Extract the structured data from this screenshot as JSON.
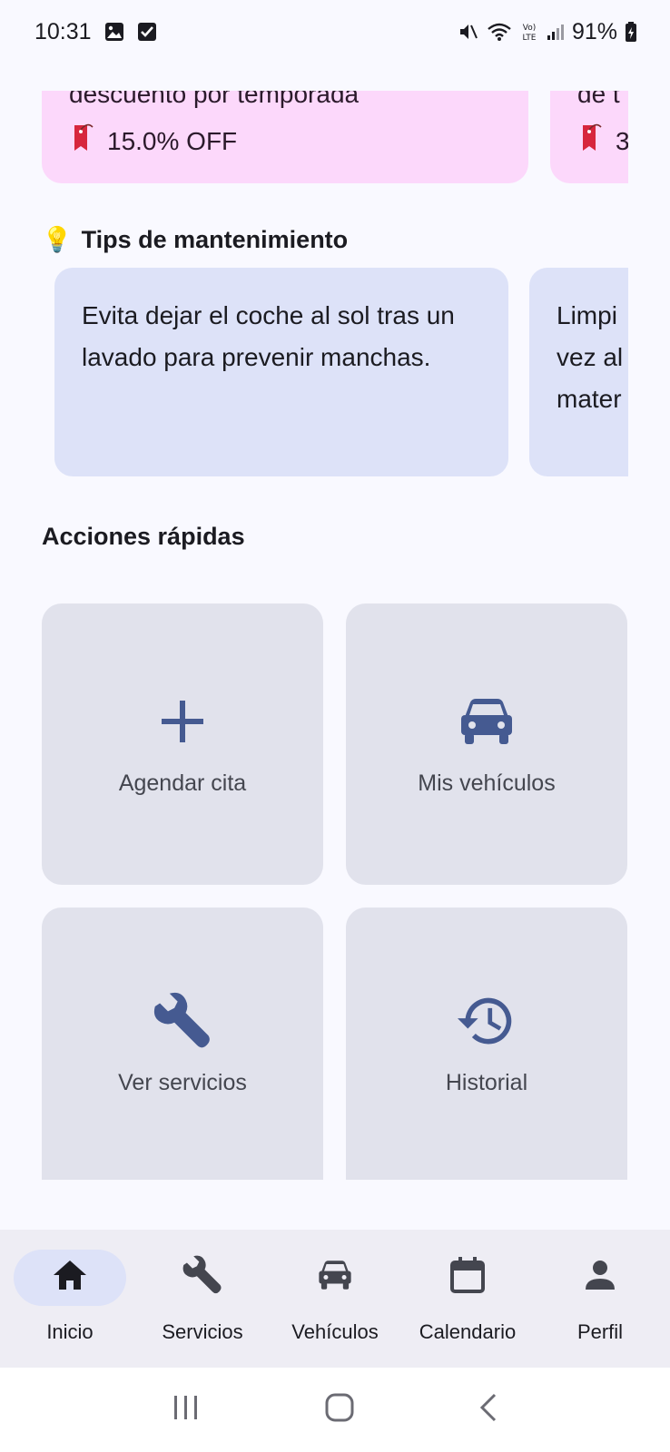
{
  "status": {
    "time": "10:31",
    "battery": "91%"
  },
  "promos": [
    {
      "description": "descuento por temporada",
      "discount": "15.0% OFF"
    },
    {
      "description": "de t",
      "discount": "3"
    }
  ],
  "tips": {
    "emoji": "💡",
    "title": "Tips de mantenimiento",
    "items": [
      "Evita dejar el coche al sol tras un lavado para prevenir manchas.",
      "Limpi\nvez al\nmater"
    ]
  },
  "actions": {
    "title": "Acciones rápidas",
    "items": [
      {
        "label": "Agendar cita",
        "icon": "plus-icon"
      },
      {
        "label": "Mis vehículos",
        "icon": "car-icon"
      },
      {
        "label": "Ver servicios",
        "icon": "wrench-icon"
      },
      {
        "label": "Historial",
        "icon": "history-icon"
      }
    ]
  },
  "nav": {
    "items": [
      {
        "label": "Inicio",
        "icon": "home-icon",
        "active": true
      },
      {
        "label": "Servicios",
        "icon": "wrench-icon",
        "active": false
      },
      {
        "label": "Vehículos",
        "icon": "car-icon",
        "active": false
      },
      {
        "label": "Calendario",
        "icon": "calendar-icon",
        "active": false
      },
      {
        "label": "Perfil",
        "icon": "person-icon",
        "active": false
      }
    ]
  },
  "colors": {
    "accent": "#455a91",
    "promo_bg": "#fcd8fb",
    "tip_bg": "#dde2f8",
    "action_bg": "#e1e2ec",
    "nav_bg": "#eeedf4"
  }
}
